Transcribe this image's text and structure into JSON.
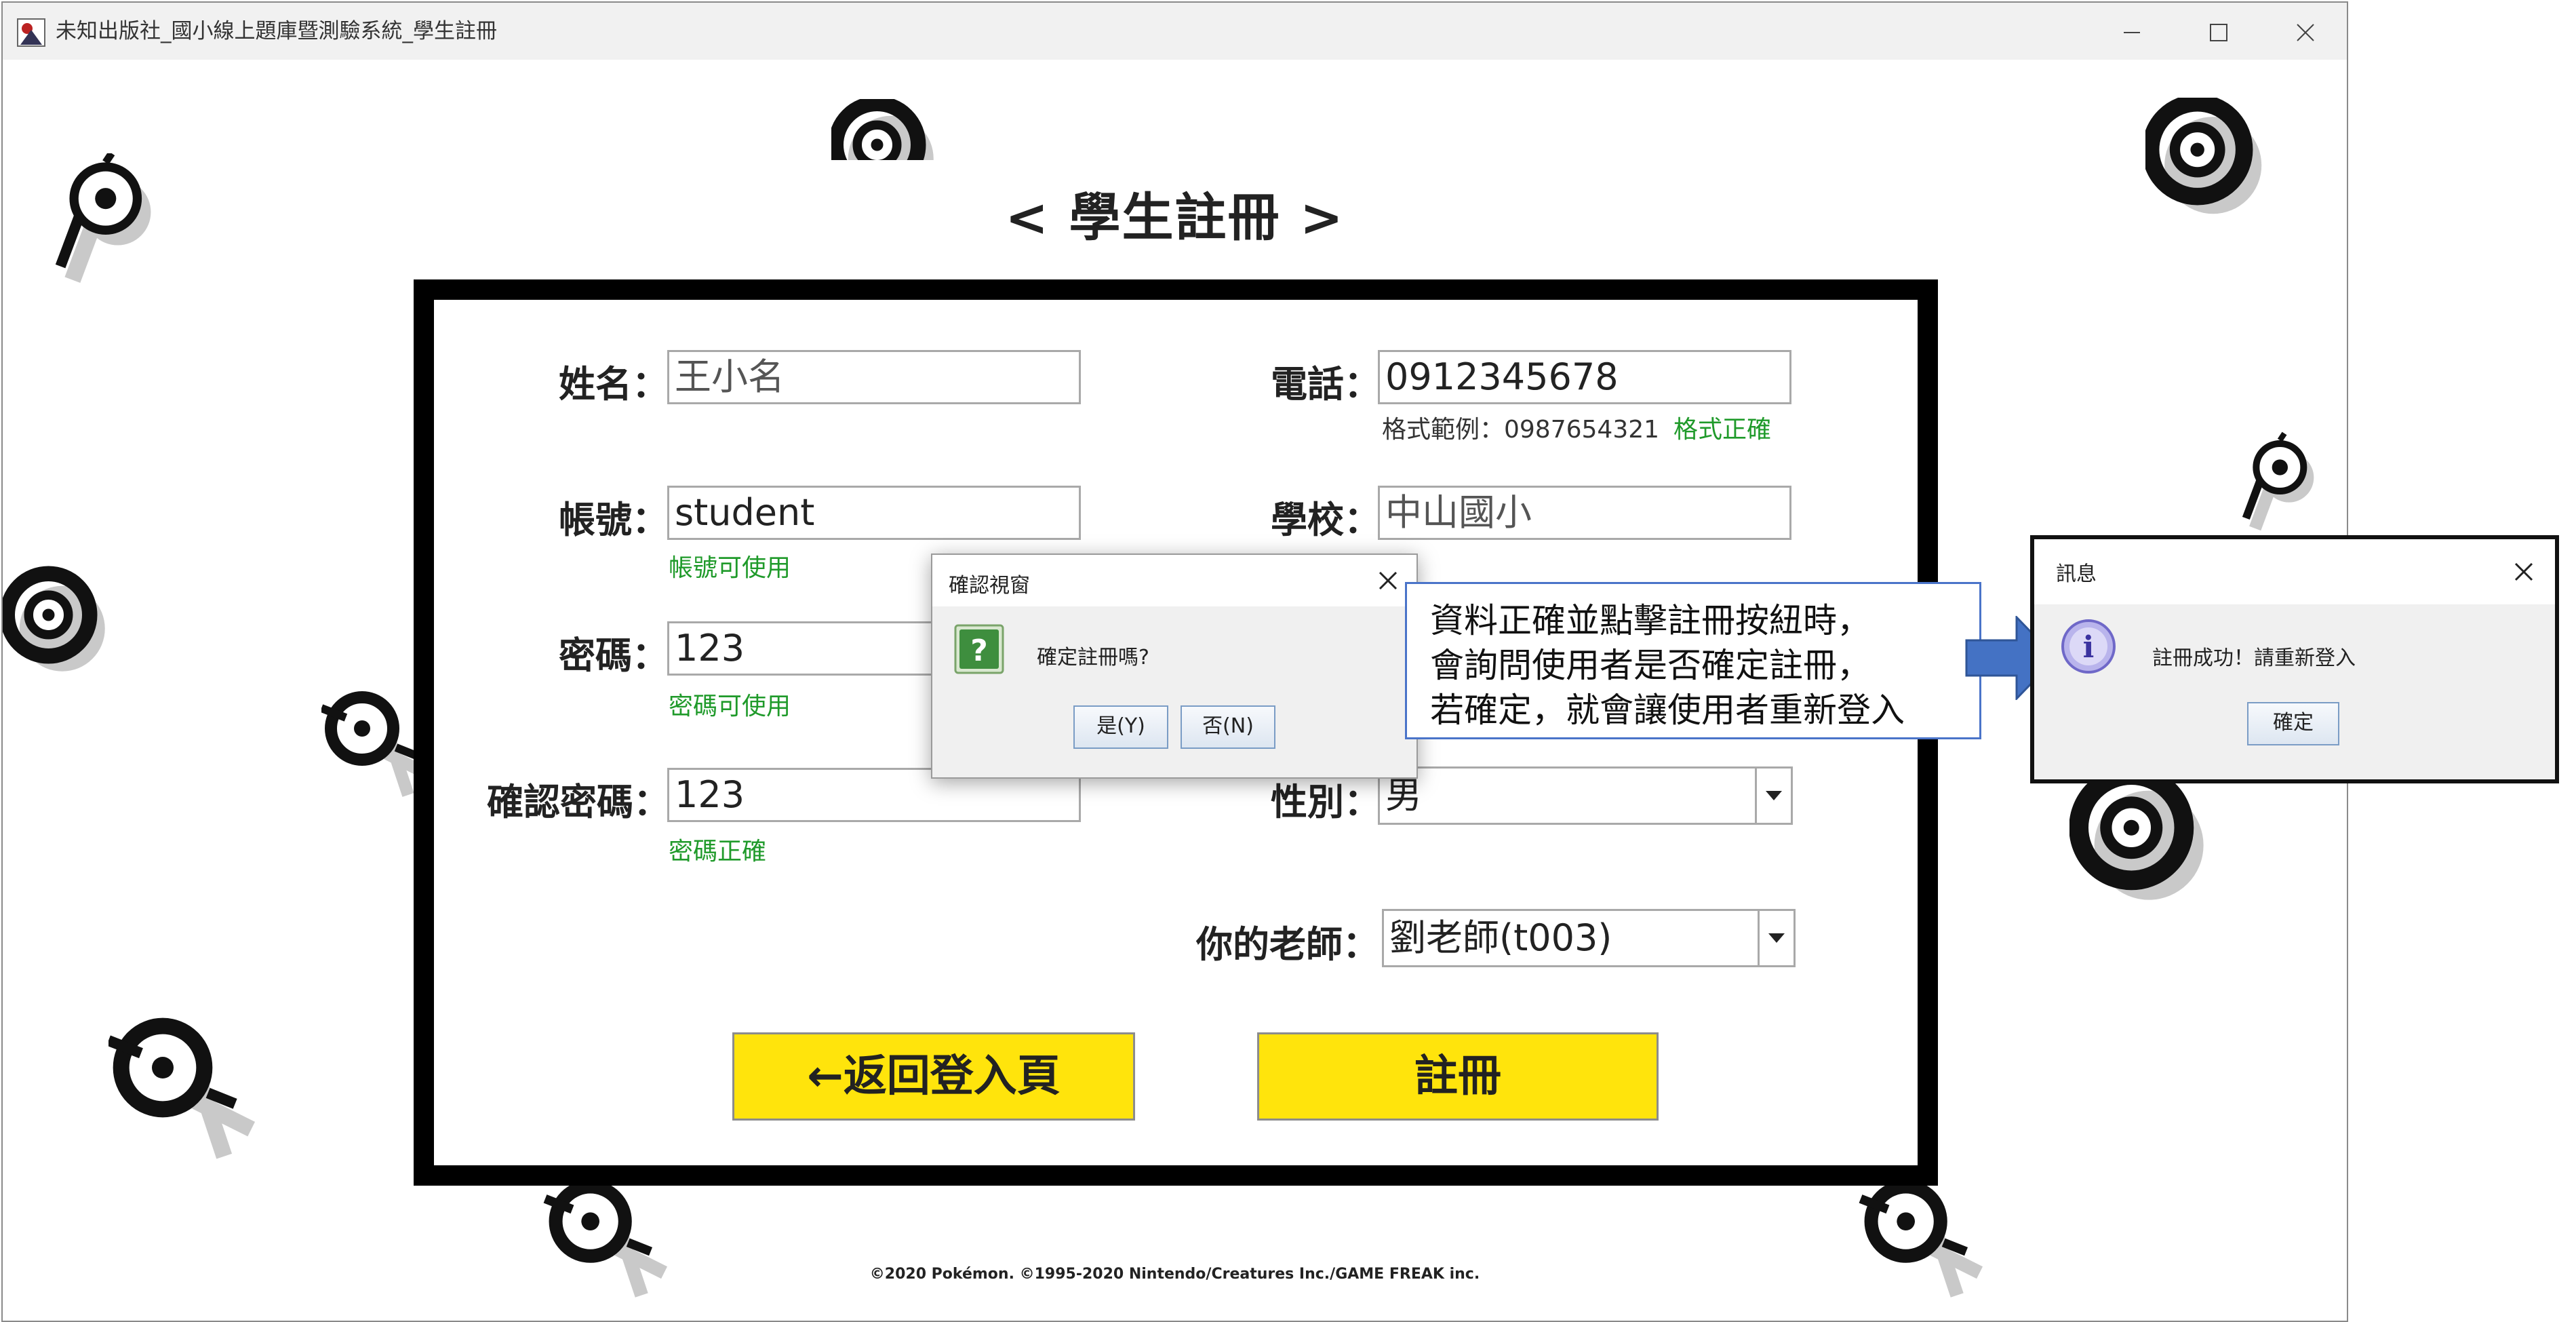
{
  "window": {
    "title": "未知出版社_國小線上題庫暨測驗系統_學生註冊"
  },
  "page": {
    "title": "< 學生註冊 >"
  },
  "form": {
    "name_label": "姓名：",
    "name_value": "王小名",
    "phone_label": "電話：",
    "phone_value": "0912345678",
    "phone_example": "格式範例：0987654321",
    "phone_status": "格式正確",
    "account_label": "帳號：",
    "account_value": "student",
    "account_status": "帳號可使用",
    "school_label": "學校：",
    "school_value": "中山國小",
    "password_label": "密碼：",
    "password_value": "123",
    "password_status": "密碼可使用",
    "confirm_label": "確認密碼：",
    "confirm_value": "123",
    "confirm_status": "密碼正確",
    "gender_label": "性別：",
    "gender_value": "男",
    "teacher_label": "你的老師：",
    "teacher_value": "劉老師(t003)",
    "back_button": "←返回登入頁",
    "register_button": "註冊"
  },
  "footer": {
    "copyright": "©2020 Pokémon. ©1995-2020 Nintendo/Creatures Inc./GAME FREAK inc."
  },
  "confirm_dialog": {
    "title": "確認視窗",
    "message": "確定註冊嗎?",
    "yes_button": "是(Y)",
    "no_button": "否(N)"
  },
  "annotation": {
    "lines": [
      "資料正確並點擊註冊按紐時，",
      "會詢問使用者是否確定註冊，",
      "若確定，就會讓使用者重新登入"
    ]
  },
  "message_dialog": {
    "title": "訊息",
    "message": "註冊成功！請重新登入",
    "ok_button": "確定"
  },
  "colors": {
    "button_yellow": "#ffe40c",
    "success_green": "#1f9a2a",
    "annotation_blue": "#4472c4",
    "question_icon_green": "#3e8e3e",
    "info_icon_purple": "#6f68c8"
  },
  "icons": {
    "confirm": "question-icon",
    "message": "info-icon",
    "arrow": "right-arrow-icon"
  }
}
